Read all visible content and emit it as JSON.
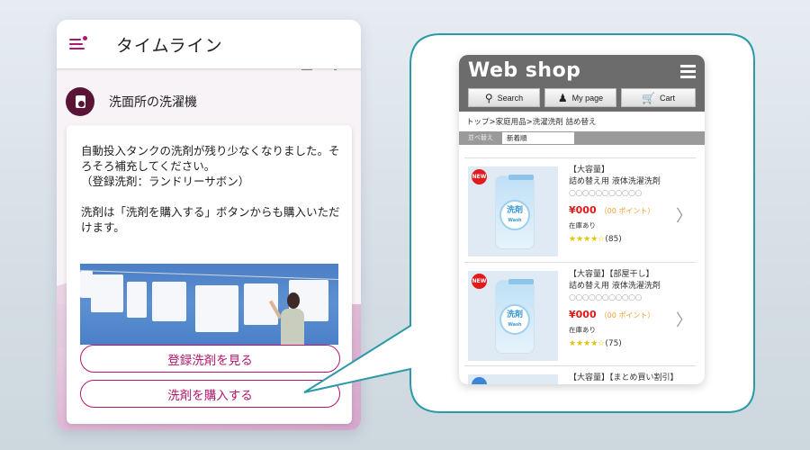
{
  "timeline_app": {
    "title": "タイムライン",
    "device": {
      "name": "洗面所の洗濯機",
      "icon": "washing-machine-icon"
    },
    "message": "自動投入タンクの洗剤が残り少なくなりました。そろそろ補充してください。\n（登録洗剤：ランドリーサボン）\n\n洗剤は「洗剤を購入する」ボタンからも購入いただけます。",
    "buttons": {
      "view_registered": "登録洗剤を見る",
      "buy_detergent": "洗剤を購入する"
    },
    "accent_color": "#b0176e"
  },
  "webshop": {
    "logo": "Web shop",
    "nav": {
      "search": "Search",
      "mypage": "My page",
      "cart": "Cart"
    },
    "breadcrumb": "トップ>家庭用品>洗濯洗剤 詰め替え",
    "sort": {
      "label": "並べ替え",
      "selected": "新着順"
    },
    "products": [
      {
        "badge": "NEW",
        "tag": "【大容量】",
        "name": "詰め替え用 液体洗濯洗剤",
        "placeholder": "○○○○○○○○○○○",
        "price": "¥000",
        "points": "（00 ポイント）",
        "stock": "在庫あり",
        "stars": "★★★★☆",
        "reviews": "(85)",
        "pouch_title": "洗剤",
        "pouch_sub": "Wash"
      },
      {
        "badge": "NEW",
        "tag": "【大容量】【部屋干し】",
        "name": "詰め替え用 液体洗濯洗剤",
        "placeholder": "○○○○○○○○○○○",
        "price": "¥000",
        "points": "（00 ポイント）",
        "stock": "在庫あり",
        "stars": "★★★★☆",
        "reviews": "(75)",
        "pouch_title": "洗剤",
        "pouch_sub": "Wash"
      },
      {
        "badge": "",
        "tag": "【大容量】【まとめ買い割引】"
      }
    ],
    "price_color": "#e01818",
    "callout_color": "#2b9aa8"
  }
}
